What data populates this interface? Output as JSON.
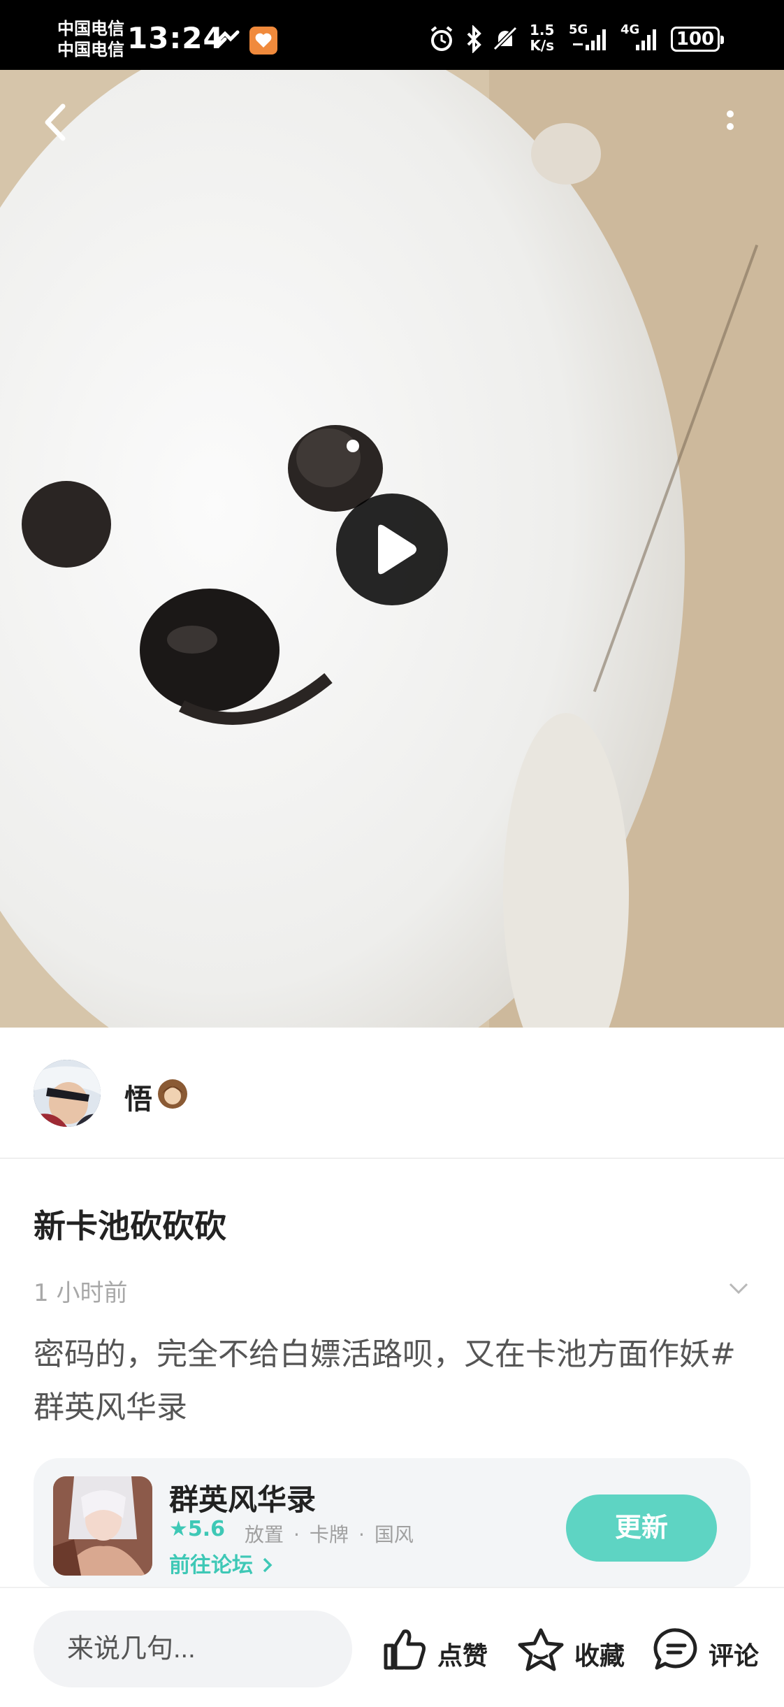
{
  "status_bar": {
    "carrier_1": "中国电信",
    "carrier_2": "中国电信",
    "time": "13:24",
    "net_speed_value": "1.5",
    "net_speed_unit": "K/s",
    "signal_1_label": "5G",
    "signal_2_label": "4G",
    "battery": "100"
  },
  "author": {
    "name": "悟"
  },
  "post": {
    "title": "新卡池砍砍砍",
    "time": "1 小时前",
    "body": "密码的，完全不给白嫖活路呗，又在卡池方面作妖#群英风华录"
  },
  "game_card": {
    "name": "群英风华录",
    "rating": "5.6",
    "tags": [
      "放置",
      "卡牌",
      "国风"
    ],
    "forum_link": "前往论坛",
    "update_button": "更新"
  },
  "bottom_bar": {
    "comment_placeholder": "来说几句...",
    "like_label": "点赞",
    "favorite_label": "收藏",
    "comment_label": "评论"
  },
  "colors": {
    "accent": "#5ed4c3",
    "accent_text": "#3ec8b6"
  }
}
